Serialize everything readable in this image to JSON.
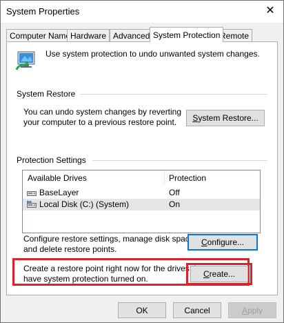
{
  "window": {
    "title": "System Properties",
    "close_glyph": "✕"
  },
  "tabs": [
    {
      "label": "Computer Name"
    },
    {
      "label": "Hardware"
    },
    {
      "label": "Advanced"
    },
    {
      "label": "System Protection"
    },
    {
      "label": "Remote"
    }
  ],
  "intro": {
    "text": "Use system protection to undo unwanted system changes.",
    "icon": "system-protection-icon"
  },
  "system_restore": {
    "group_label": "System Restore",
    "description_line1": "You can undo system changes by reverting",
    "description_line2": "your computer to a previous restore point.",
    "button_label_first": "S",
    "button_label_rest": "ystem Restore..."
  },
  "protection_settings": {
    "group_label": "Protection Settings",
    "columns": [
      "Available Drives",
      "Protection"
    ],
    "drives": [
      {
        "name": "BaseLayer",
        "protection": "Off",
        "icon": "drive-icon"
      },
      {
        "name": "Local Disk (C:) (System)",
        "protection": "On",
        "icon": "system-drive-icon"
      }
    ],
    "configure_line1": "Configure restore settings, manage disk space,",
    "configure_line2": "and delete restore points.",
    "configure_button_first": "C",
    "configure_button_rest": "onfigure...",
    "create_line1": "Create a restore point right now for the drives that",
    "create_line2": "have system protection turned on.",
    "create_button_first": "C",
    "create_button_rest": "reate..."
  },
  "footer": {
    "ok_label": "OK",
    "cancel_label": "Cancel",
    "apply_label_first": "A",
    "apply_label_rest": "pply"
  },
  "colors": {
    "highlight": "#d8232a",
    "focus": "#0078d7"
  }
}
